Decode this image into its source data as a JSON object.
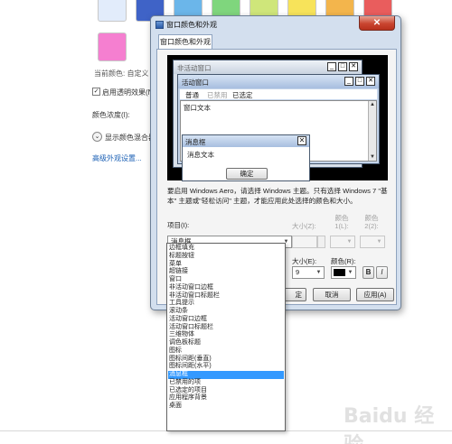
{
  "background": {
    "swatch_colors": [
      "#e2ecfb",
      "#3f63c7",
      "#6bb6ea",
      "#7fd67d",
      "#cfe67a",
      "#f7e35a",
      "#f3b54c",
      "#e95d5d",
      "#f57fd0"
    ],
    "current_color_label": "当前颜色: 自定义",
    "transparency_label": "启用透明效果(N)",
    "transparency_checked": "✓",
    "color_intensity_label": "颜色浓度(I):",
    "mixer_label": "显示颜色混合器(",
    "advanced_link": "高级外观设置..."
  },
  "dialog": {
    "title": "窗口颜色和外观",
    "close_glyph": "✕",
    "tab_label": "窗口颜色和外观",
    "preview": {
      "inactive_title": "非活动窗口",
      "active_title": "活动窗口",
      "controls": [
        "_",
        "□",
        "✕"
      ],
      "menu": [
        "普通",
        "已禁用",
        "已选定"
      ],
      "window_text": "窗口文本",
      "message_title": "消息框",
      "message_close": "✕",
      "message_text": "消息文本",
      "ok_label": "确定",
      "scroll_up": "▲",
      "scroll_down": "▼"
    },
    "description": "要启用 Windows Aero，请选择 Windows 主题。只有选择 Windows 7 \"基本\" 主题或\"轻松访问\" 主题，才能应用此处选择的颜色和大小。",
    "item_label": "项目(I):",
    "item_value": "消息框",
    "size_label_top": "大小(Z):",
    "color1_label": "颜色 1(L):",
    "color2_label": "颜色 2(2):",
    "font_size_label": "大小(E):",
    "font_size_value": "9",
    "font_color_label": "颜色(R):",
    "bold_label": "B",
    "italic_label": "I",
    "ok_button_partial": "定",
    "cancel_button": "取消",
    "apply_button": "应用(A)",
    "dropdown_glyph": "▼",
    "font_color_hex": "#000000"
  },
  "dropdown": {
    "items": [
      "边框填充",
      "标题按钮",
      "菜单",
      "超链接",
      "窗口",
      "非活动窗口边框",
      "非活动窗口标题栏",
      "工具提示",
      "滚动条",
      "活动窗口边框",
      "活动窗口标题栏",
      "三维物体",
      "调色板标题",
      "图标",
      "图标间距(垂直)",
      "图标间距(水平)",
      "消息框",
      "已禁用的项",
      "已选定的项目",
      "应用程序背景",
      "桌面"
    ],
    "selected": "消息框",
    "selected_color": "#3399ff"
  },
  "watermark": "Baidu 经验"
}
